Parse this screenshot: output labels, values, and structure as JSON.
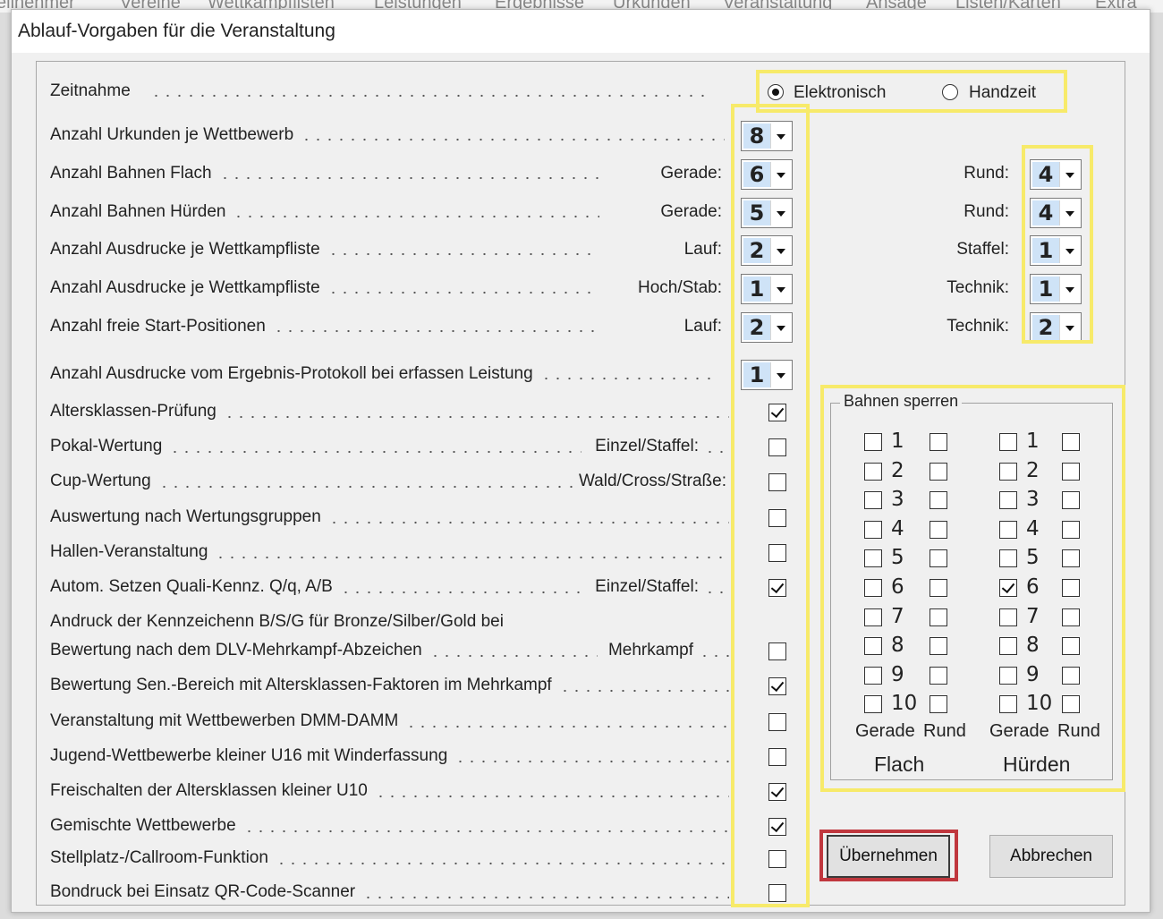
{
  "menubar": [
    "Teilnehmer",
    "Vereine",
    "Wettkampflisten",
    "Leistungen",
    "Ergebnisse",
    "Urkunden",
    "Veranstaltung",
    "Ansage",
    "Listen/Karten",
    "Extra"
  ],
  "dialog_title": "Ablauf-Vorgaben für die Veranstaltung",
  "zeitnahme": {
    "label": "Zeitnahme",
    "options": [
      "Elektronisch",
      "Handzeit"
    ],
    "selected": "Elektronisch"
  },
  "rows": [
    {
      "label": "Anzahl Urkunden je Wettbewerb",
      "mid_label": "",
      "mid_value": "8",
      "right_label": "",
      "right_value": ""
    },
    {
      "label": "Anzahl Bahnen   Flach",
      "mid_label": "Gerade:",
      "mid_value": "6",
      "right_label": "Rund:",
      "right_value": "4"
    },
    {
      "label": "Anzahl Bahnen   Hürden",
      "mid_label": "Gerade:",
      "mid_value": "5",
      "right_label": "Rund:",
      "right_value": "4"
    },
    {
      "label": "Anzahl Ausdrucke je Wettkampfliste",
      "mid_label": "Lauf:",
      "mid_value": "2",
      "right_label": "Staffel:",
      "right_value": "1"
    },
    {
      "label": "Anzahl Ausdrucke je Wettkampfliste",
      "mid_label": "Hoch/Stab:",
      "mid_value": "1",
      "right_label": "Technik:",
      "right_value": "1"
    },
    {
      "label": "Anzahl freie Start-Positionen",
      "mid_label": "Lauf:",
      "mid_value": "2",
      "right_label": "Technik:",
      "right_value": "2"
    },
    {
      "label": "Anzahl Ausdrucke vom Ergebnis-Protokoll bei erfassen Leistung",
      "mid_label": "",
      "mid_value": "1",
      "right_label": "",
      "right_value": ""
    }
  ],
  "checks": [
    {
      "label": "Altersklassen-Prüfung",
      "suffix": "",
      "checked": true
    },
    {
      "label": "Pokal-Wertung",
      "suffix": "Einzel/Staffel:",
      "checked": false
    },
    {
      "label": "Cup-Wertung",
      "suffix": "Wald/Cross/Straße:",
      "checked": false
    },
    {
      "label": "Auswertung nach Wertungsgruppen",
      "suffix": "",
      "checked": false
    },
    {
      "label": "Hallen-Veranstaltung",
      "suffix": "",
      "checked": false
    },
    {
      "label": "Autom. Setzen Quali-Kennz. Q/q, A/B",
      "suffix": "Einzel/Staffel:",
      "checked": true
    },
    {
      "label": "Andruck der Kennzeichenn B/S/G für Bronze/Silber/Gold bei",
      "label2": "Bewertung nach dem DLV-Mehrkampf-Abzeichen",
      "suffix": "Mehrkampf",
      "checked": false
    },
    {
      "label": "Bewertung Sen.-Bereich mit Altersklassen-Faktoren im Mehrkampf",
      "suffix": "",
      "checked": true
    },
    {
      "label": "Veranstaltung mit Wettbewerben DMM-DAMM",
      "suffix": "",
      "checked": false
    },
    {
      "label": "Jugend-Wettbewerbe kleiner U16 mit Winderfassung",
      "suffix": "",
      "checked": false
    },
    {
      "label": "Freischalten der Altersklassen kleiner U10",
      "suffix": "",
      "checked": true
    },
    {
      "label": "Gemischte Wettbewerbe",
      "suffix": "",
      "checked": true
    },
    {
      "label": "Stellplatz-/Callroom-Funktion",
      "suffix": "",
      "checked": false
    },
    {
      "label": "Bondruck bei Einsatz QR-Code-Scanner",
      "suffix": "",
      "checked": false
    }
  ],
  "bahnen": {
    "title": "Bahnen sperren",
    "lanes": [
      "1",
      "2",
      "3",
      "4",
      "5",
      "6",
      "7",
      "8",
      "9",
      "10"
    ],
    "col_labels": [
      "Gerade",
      "Rund",
      "Gerade",
      "Rund"
    ],
    "group_labels": [
      "Flach",
      "Hürden"
    ],
    "checked_huerden_gerade": [
      "6"
    ]
  },
  "buttons": {
    "ok": "Übernehmen",
    "cancel": "Abbrechen"
  },
  "highlight_colors": {
    "yellow": "#f7ea6a",
    "red": "#c0373e"
  }
}
